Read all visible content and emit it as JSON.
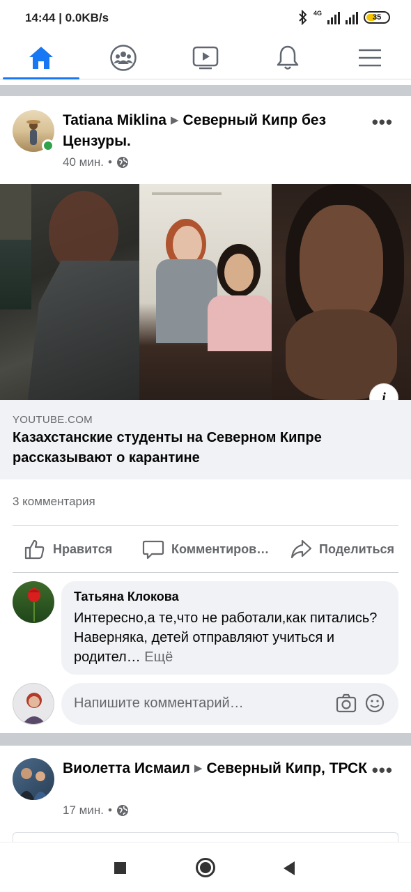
{
  "status_bar": {
    "time": "14:44 | 0.0KB/s",
    "network": "4G",
    "battery": "35"
  },
  "nav": {
    "tabs": [
      {
        "icon": "home-icon",
        "active": true
      },
      {
        "icon": "groups-icon",
        "active": false
      },
      {
        "icon": "watch-icon",
        "active": false
      },
      {
        "icon": "notifications-icon",
        "active": false
      },
      {
        "icon": "menu-icon",
        "active": false
      }
    ],
    "accent": "#1877f2"
  },
  "post1": {
    "author": "Tatiana Miklina",
    "group": "Северный Кипр без Цензуры.",
    "time": "40 мин.",
    "link_domain": "YOUTUBE.COM",
    "link_title": "Казахстанские студенты на Северном Кипре рассказывают о карантине",
    "comments_count": "3 комментария",
    "actions": {
      "like": "Нравится",
      "comment": "Комментиров…",
      "share": "Поделиться"
    },
    "comment": {
      "author": "Татьяна Клокова",
      "text": "Интересно,а те,что не работали,как питались? Наверняка, детей отправляют учиться и родител…",
      "more": "Ещё"
    },
    "comment_placeholder": "Напишите комментарий…"
  },
  "post2": {
    "author": "Виолетта Исмаил",
    "group": "Северный Кипр, ТРСК",
    "time": "17 мин."
  }
}
